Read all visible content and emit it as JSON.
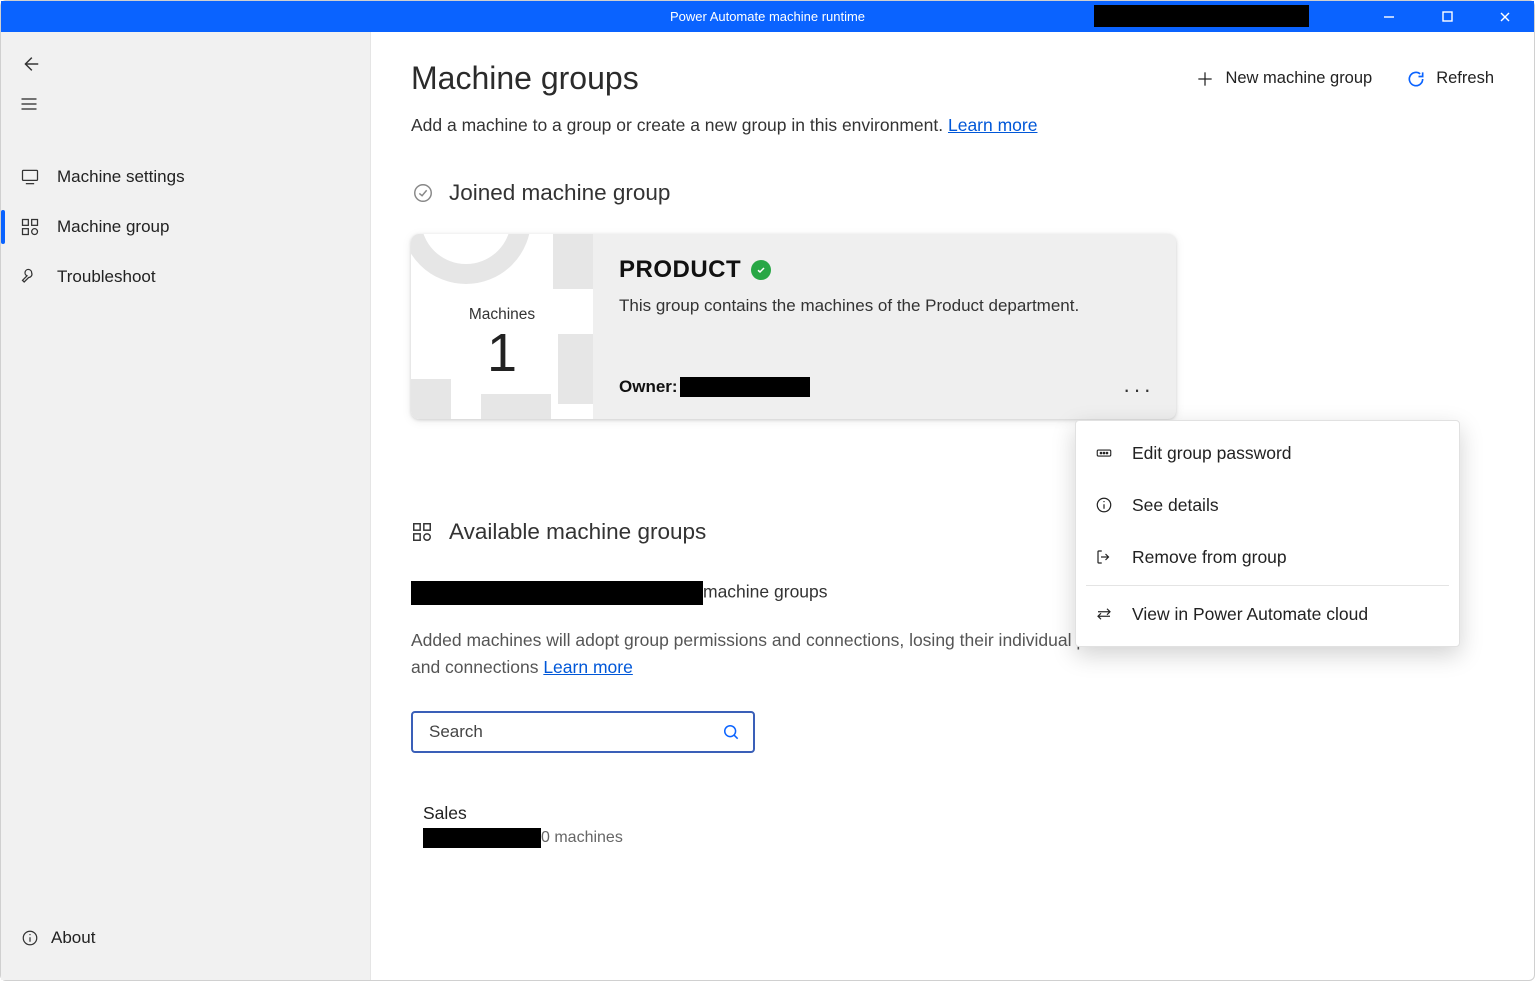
{
  "titlebar": {
    "title": "Power Automate machine runtime"
  },
  "sidebar": {
    "items": [
      {
        "label": "Machine settings"
      },
      {
        "label": "Machine group"
      },
      {
        "label": "Troubleshoot"
      }
    ],
    "about": "About"
  },
  "header": {
    "title": "Machine groups",
    "new_group": "New machine group",
    "refresh": "Refresh"
  },
  "subtext": {
    "pre": "Add a machine to a group or create a new group in this environment. ",
    "learn_more": "Learn more"
  },
  "joined": {
    "heading": "Joined machine group",
    "tile_label": "Machines",
    "tile_count": "1",
    "group_name": "PRODUCT",
    "desc": "This group contains the machines of the Product department.",
    "owner_label": "Owner:"
  },
  "available": {
    "heading": "Available machine groups",
    "sub_post": "machine groups",
    "help_text": "Added machines will adopt group permissions and connections, losing their individual permissions and connections ",
    "learn_more": "Learn more",
    "search_placeholder": "Search",
    "items": [
      {
        "name": "Sales",
        "meta_post": "0 machines"
      }
    ]
  },
  "ctx": {
    "edit": "Edit group password",
    "details": "See details",
    "remove": "Remove from group",
    "view_cloud": "View in Power Automate cloud"
  }
}
